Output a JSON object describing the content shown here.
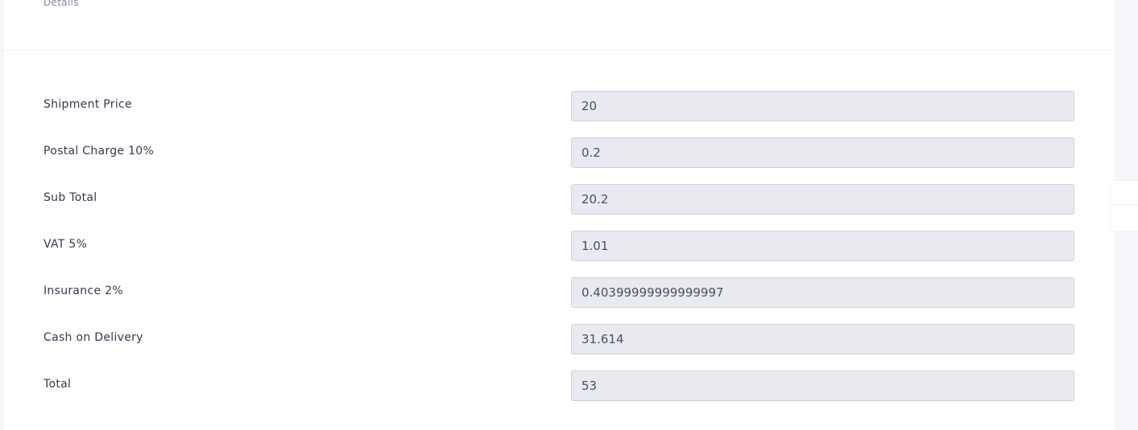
{
  "header": {
    "title": "Details"
  },
  "fields": [
    {
      "label": "Shipment Price",
      "value": "20"
    },
    {
      "label": "Postal Charge 10%",
      "value": "0.2"
    },
    {
      "label": "Sub Total",
      "value": "20.2"
    },
    {
      "label": "VAT 5%",
      "value": "1.01"
    },
    {
      "label": "Insurance 2%",
      "value": "0.40399999999999997"
    },
    {
      "label": "Cash on Delivery",
      "value": "31.614"
    },
    {
      "label": "Total",
      "value": "53"
    }
  ]
}
